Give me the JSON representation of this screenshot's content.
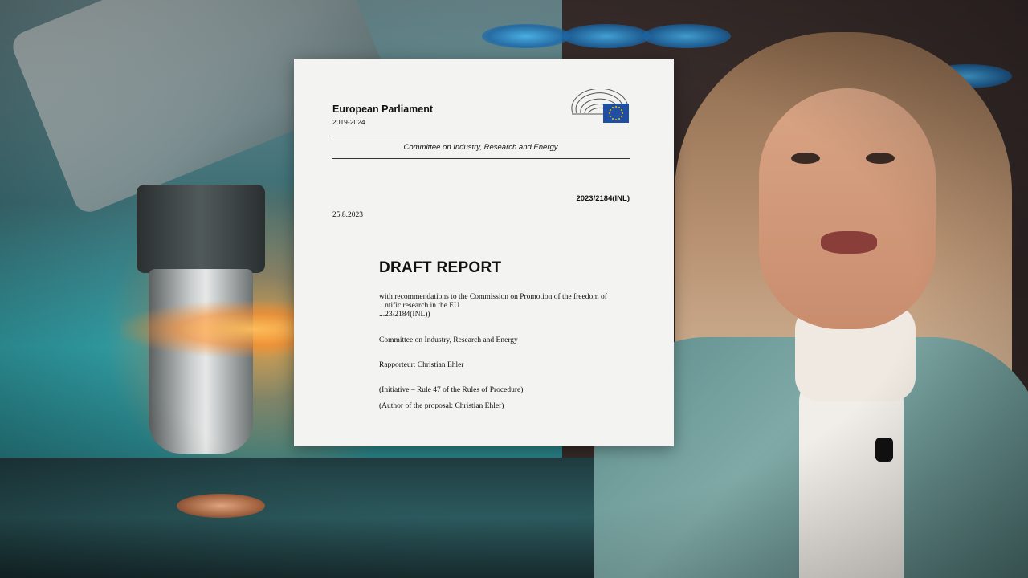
{
  "document": {
    "organization": "European Parliament",
    "term": "2019-2024",
    "committee_header": "Committee on Industry, Research and Energy",
    "reference": "2023/2184(INL)",
    "date": "25.8.2023",
    "title": "DRAFT REPORT",
    "subtitle_lines": [
      "with recommendations to the Commission on Promotion of the freedom of",
      "...ntific research in the EU",
      "...23/2184(INL))"
    ],
    "committee_line": "Committee on Industry, Research and Energy",
    "rapporteur": "Rapporteur: Christian Ehler",
    "initiative": "(Initiative – Rule 47 of the Rules of Procedure)",
    "author": "(Author of the proposal: Christian Ehler)"
  },
  "colors": {
    "eu_blue": "#1f4fa3",
    "eu_star": "#f4c400",
    "paper": "#f3f3f1"
  },
  "icons": [
    "european-parliament-logo-icon",
    "eu-flag-icon"
  ]
}
